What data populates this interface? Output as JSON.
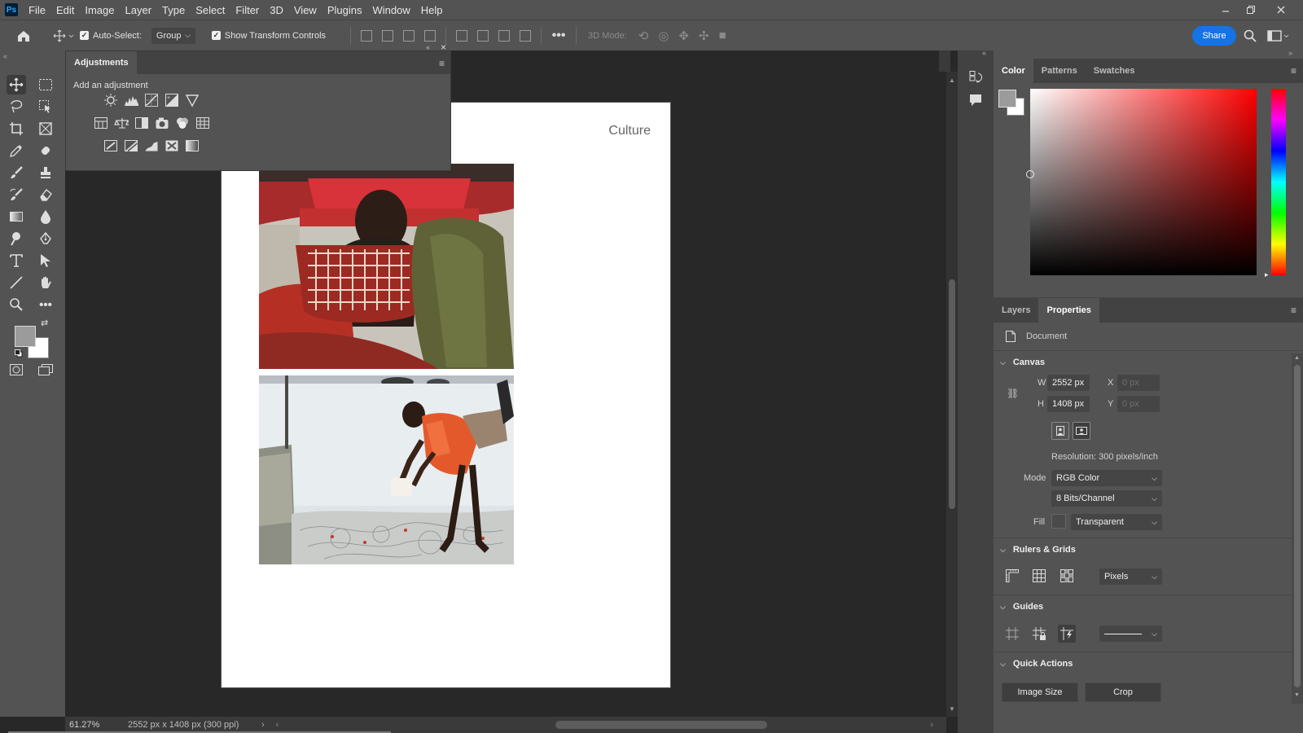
{
  "app": {
    "logo": "Ps"
  },
  "menu": [
    "File",
    "Edit",
    "Image",
    "Layer",
    "Type",
    "Select",
    "Filter",
    "3D",
    "View",
    "Plugins",
    "Window",
    "Help"
  ],
  "options": {
    "auto_select_label": "Auto-Select:",
    "auto_select_target": "Group",
    "show_transform_label": "Show Transform Controls",
    "mode3d_label": "3D Mode:",
    "share_label": "Share"
  },
  "adjustments": {
    "tab": "Adjustments",
    "hint": "Add an adjustment"
  },
  "canvas": {
    "text": "Culture"
  },
  "status": {
    "zoom": "61.27%",
    "doc_info": "2552 px x 1408 px (300 ppi)"
  },
  "color_panel": {
    "tabs": [
      "Color",
      "Patterns",
      "Swatches"
    ]
  },
  "properties": {
    "tabs": [
      "Layers",
      "Properties"
    ],
    "doc_label": "Document",
    "canvas_section": "Canvas",
    "w_label": "W",
    "w_value": "2552 px",
    "h_label": "H",
    "h_value": "1408 px",
    "x_label": "X",
    "x_value": "0 px",
    "y_label": "Y",
    "y_value": "0 px",
    "resolution": "Resolution: 300 pixels/inch",
    "mode_label": "Mode",
    "mode_value": "RGB Color",
    "bits_value": "8 Bits/Channel",
    "fill_label": "Fill",
    "fill_value": "Transparent",
    "rulers_section": "Rulers & Grids",
    "units_value": "Pixels",
    "guides_section": "Guides",
    "quick_section": "Quick Actions",
    "image_size_label": "Image Size",
    "crop_label": "Crop"
  },
  "colors": {
    "accent": "#1473e6",
    "panel": "#535353",
    "dark": "#282828"
  }
}
